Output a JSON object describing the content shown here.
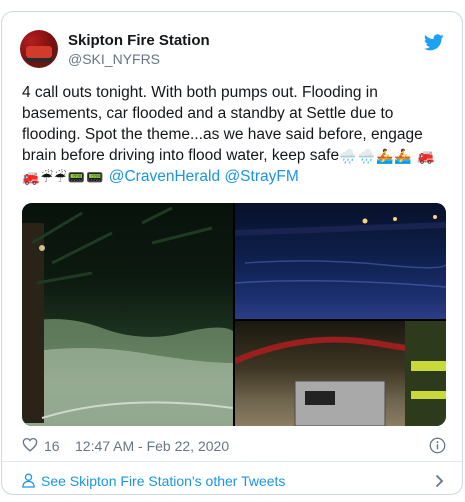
{
  "author": {
    "display_name": "Skipton Fire Station",
    "handle": "@SKI_NYFRS",
    "avatar_icon": "fire-engine-avatar"
  },
  "tweet": {
    "text": "4 call outs tonight. With both pumps out. Flooding in basements, car flooded and a standby at Settle due to flooding. Spot the theme...as we have said before, engage brain before driving into flood water, keep safe",
    "emojis_line1": [
      "🌧️",
      "🌧️",
      "🚣",
      "🚣"
    ],
    "emojis_line2": [
      "🚒",
      "🚒",
      "☔",
      "☔",
      "📟",
      "📟"
    ],
    "mentions": [
      "@CravenHerald",
      "@StrayFM"
    ]
  },
  "media": {
    "photos": [
      "flooded-garden-night",
      "flooded-road-blue",
      "pump-hose-floodwater"
    ]
  },
  "meta": {
    "like_count": "16",
    "timestamp": "12:47 AM - Feb 22, 2020"
  },
  "footer": {
    "more_tweets_label": "See Skipton Fire Station's other Tweets"
  },
  "colors": {
    "link": "#1b95e0",
    "muted": "#657786",
    "twitter_blue": "#1da1f2",
    "border": "#cfd9de"
  }
}
